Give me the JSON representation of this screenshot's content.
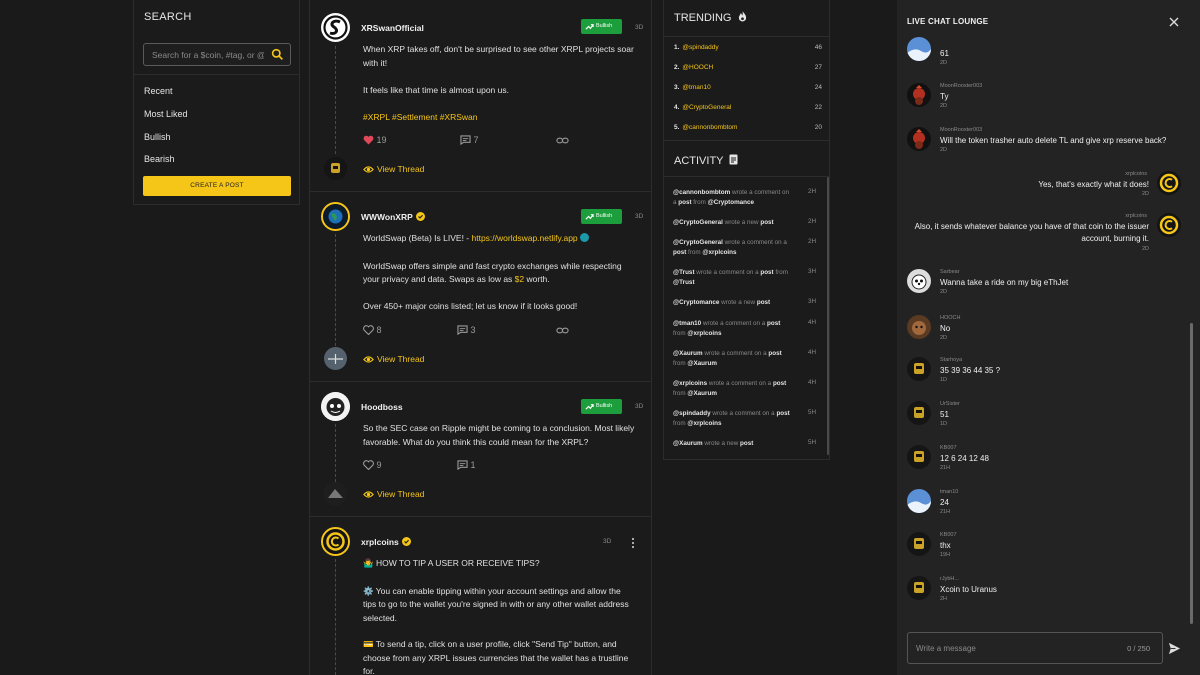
{
  "search": {
    "title": "SEARCH",
    "placeholder": "Search for a $coin, #tag, or @",
    "filters": [
      "Recent",
      "Most Liked",
      "Bullish",
      "Bearish"
    ],
    "create_label": "CREATE A POST"
  },
  "feed": {
    "view_thread_label": "View Thread",
    "posts": [
      {
        "user": "XRSwanOfficial",
        "badge": "Bullish",
        "age": "3D",
        "lines": [
          "When XRP takes off, don't be surprised to see other XRPL projects soar with it!",
          "It feels like that time is almost upon us."
        ],
        "tags": "#XRPL #Settlement #XRSwan",
        "likes": "19",
        "comments": "7",
        "liked": true
      },
      {
        "user": "WWWonXRP",
        "badge": "Bullish",
        "age": "3D",
        "line1_prefix": "WorldSwap (Beta) Is LIVE! - ",
        "line1_link": "https://worldswap.netlify.app",
        "line2_prefix": "WorldSwap offers simple and fast crypto exchanges while respecting your privacy and data. Swaps as low as ",
        "line2_price": "$2",
        "line2_suffix": " worth.",
        "line3": "Over 450+ major coins listed; let us know if it looks good!",
        "likes": "8",
        "comments": "3"
      },
      {
        "user": "Hoodboss",
        "badge": "Bullish",
        "age": "3D",
        "text": "So the SEC case on Ripple might be coming to a conclusion. Most likely favorable. What do you think this could mean for the XRPL?",
        "likes": "9",
        "comments": "1"
      },
      {
        "user": "xrplcoins",
        "age": "3D",
        "line1": "🤷‍♂️ HOW TO TIP A USER OR RECEIVE TIPS?",
        "line2": "⚙️ You can enable tipping within your account settings and allow the tips to go to the wallet you're signed in with or any other wallet address selected.",
        "line3": "💳 To send a tip, click on a user profile, click \"Send Tip\" button, and choose from any XRPL issues currencies that the wallet has a trustline for."
      }
    ]
  },
  "trending": {
    "title": "TRENDING",
    "items": [
      {
        "rank": "1.",
        "user": "@spindaddy",
        "count": "46"
      },
      {
        "rank": "2.",
        "user": "@HOOCH",
        "count": "27"
      },
      {
        "rank": "3.",
        "user": "@tman10",
        "count": "24"
      },
      {
        "rank": "4.",
        "user": "@CryptoGeneral",
        "count": "22"
      },
      {
        "rank": "5.",
        "user": "@cannonbombtom",
        "count": "20"
      }
    ]
  },
  "activity": {
    "title": "ACTIVITY",
    "items": [
      {
        "parts": [
          [
            "b",
            "@cannonbombtom"
          ],
          [
            "t",
            " wrote a comment on a "
          ],
          [
            "b",
            "post"
          ],
          [
            "t",
            " from "
          ],
          [
            "b",
            "@Cryptomance"
          ]
        ],
        "time": "2H"
      },
      {
        "parts": [
          [
            "b",
            "@CryptoGeneral"
          ],
          [
            "t",
            " wrote a new "
          ],
          [
            "b",
            "post"
          ]
        ],
        "time": "2H"
      },
      {
        "parts": [
          [
            "b",
            "@CryptoGeneral"
          ],
          [
            "t",
            " wrote a comment on a "
          ],
          [
            "b",
            "post"
          ],
          [
            "t",
            " from "
          ],
          [
            "b",
            "@xrplcoins"
          ]
        ],
        "time": "2H"
      },
      {
        "parts": [
          [
            "b",
            "@Trust"
          ],
          [
            "t",
            " wrote a comment on a "
          ],
          [
            "b",
            "post"
          ],
          [
            "t",
            " from "
          ],
          [
            "b",
            "@Trust"
          ]
        ],
        "time": "3H"
      },
      {
        "parts": [
          [
            "b",
            "@Cryptomance"
          ],
          [
            "t",
            " wrote a new "
          ],
          [
            "b",
            "post"
          ]
        ],
        "time": "3H"
      },
      {
        "parts": [
          [
            "b",
            "@tman10"
          ],
          [
            "t",
            " wrote a comment on a "
          ],
          [
            "b",
            "post"
          ],
          [
            "t",
            " from "
          ],
          [
            "b",
            "@xrplcoins"
          ]
        ],
        "time": "4H"
      },
      {
        "parts": [
          [
            "b",
            "@Xaurum"
          ],
          [
            "t",
            " wrote a comment on a "
          ],
          [
            "b",
            "post"
          ],
          [
            "t",
            " from "
          ],
          [
            "b",
            "@Xaurum"
          ]
        ],
        "time": "4H"
      },
      {
        "parts": [
          [
            "b",
            "@xrplcoins"
          ],
          [
            "t",
            " wrote a comment on a "
          ],
          [
            "b",
            "post"
          ],
          [
            "t",
            " from "
          ],
          [
            "b",
            "@Xaurum"
          ]
        ],
        "time": "4H"
      },
      {
        "parts": [
          [
            "b",
            "@spindaddy"
          ],
          [
            "t",
            " wrote a comment on a "
          ],
          [
            "b",
            "post"
          ],
          [
            "t",
            " from "
          ],
          [
            "b",
            "@xrplcoins"
          ]
        ],
        "time": "5H"
      },
      {
        "parts": [
          [
            "b",
            "@Xaurum"
          ],
          [
            "t",
            " wrote a new "
          ],
          [
            "b",
            "post"
          ]
        ],
        "time": "5H"
      }
    ]
  },
  "chat": {
    "title": "LIVE CHAT LOUNGE",
    "messages": [
      {
        "name": "",
        "text": "61",
        "time": "2D",
        "avatar": "avatar-sky"
      },
      {
        "name": "MoonRooster003",
        "text": "Ty",
        "time": "2D",
        "avatar": "avatar-rooster"
      },
      {
        "name": "MoonRooster003",
        "text": "Will the token trasher auto delete TL and give xrp reserve back?",
        "time": "2D",
        "avatar": "avatar-rooster"
      },
      {
        "name": "xrplcoins",
        "text": "Yes, that's exactly what it does!",
        "time": "2D",
        "avatar": "avatar-coin",
        "own": true
      },
      {
        "name": "xrplcoins",
        "text": "Also, it sends whatever balance you have of that coin to the issuer account, burning it.",
        "time": "2D",
        "avatar": "avatar-coin",
        "own": true
      },
      {
        "name": "Sarbear",
        "text": "Wanna take a ride on my big eThJet",
        "time": "2D",
        "avatar": "avatar-bear"
      },
      {
        "name": "HOOCH",
        "text": "No",
        "time": "2D",
        "avatar": "avatar-dog"
      },
      {
        "name": "Starhoya",
        "text": "35 39 36 44 35 ?",
        "time": "1D",
        "avatar": "avatar-hood"
      },
      {
        "name": "UrSister",
        "text": "51",
        "time": "1D",
        "avatar": "avatar-hood"
      },
      {
        "name": "KB007",
        "text": "12 6 24 12 48",
        "time": "21H",
        "avatar": "avatar-hood"
      },
      {
        "name": "tman10",
        "text": "24",
        "time": "21H",
        "avatar": "avatar-sky"
      },
      {
        "name": "KB007",
        "text": "thx",
        "time": "19H",
        "avatar": "avatar-hood"
      },
      {
        "name": "rJybH...",
        "text": "Xcoin to Uranus",
        "time": "2H",
        "avatar": "avatar-hood"
      }
    ],
    "input_placeholder": "Write a message",
    "counter": "0 / 250"
  },
  "colors": {
    "accent": "#f5c518",
    "bullish": "#1c9e3c",
    "like": "#e0485a"
  }
}
